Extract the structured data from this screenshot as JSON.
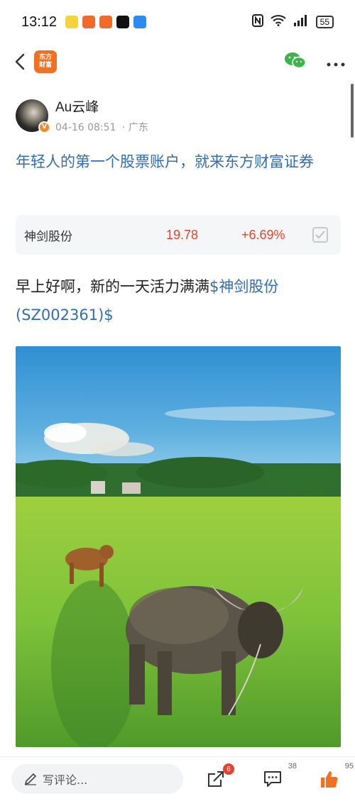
{
  "status_bar": {
    "time": "13:12",
    "battery": "55",
    "notification_icons": [
      {
        "name": "app-notif-icon",
        "color": "#f5d33a"
      },
      {
        "name": "app-notif-icon",
        "color": "#f06a2a"
      },
      {
        "name": "app-notif-icon",
        "color": "#f06a2a"
      },
      {
        "name": "capcut-icon",
        "color": "#111111"
      },
      {
        "name": "app-notif-icon",
        "color": "#2a8cf0"
      }
    ]
  },
  "nav": {
    "logo_line1": "东方",
    "logo_line2": "财富",
    "brand_color": "#f27022"
  },
  "author": {
    "name": "Au云峰",
    "time": "04-16 08:51",
    "location": "· 广东",
    "verified_badge": "V"
  },
  "headline": "年轻人的第一个股票账户，就来东方财富证券",
  "stock": {
    "name": "神剑股份",
    "price": "19.78",
    "change": "+6.69%",
    "color": "#e2452c"
  },
  "post": {
    "text": "早上好啊，新的一天活力满满",
    "stock_tag": "$神剑股份(SZ002361)$"
  },
  "bottom_bar": {
    "comment_placeholder": "写评论...",
    "share_badge": "6",
    "comment_count": "38",
    "like_count": "95",
    "like_color": "#f27022"
  }
}
